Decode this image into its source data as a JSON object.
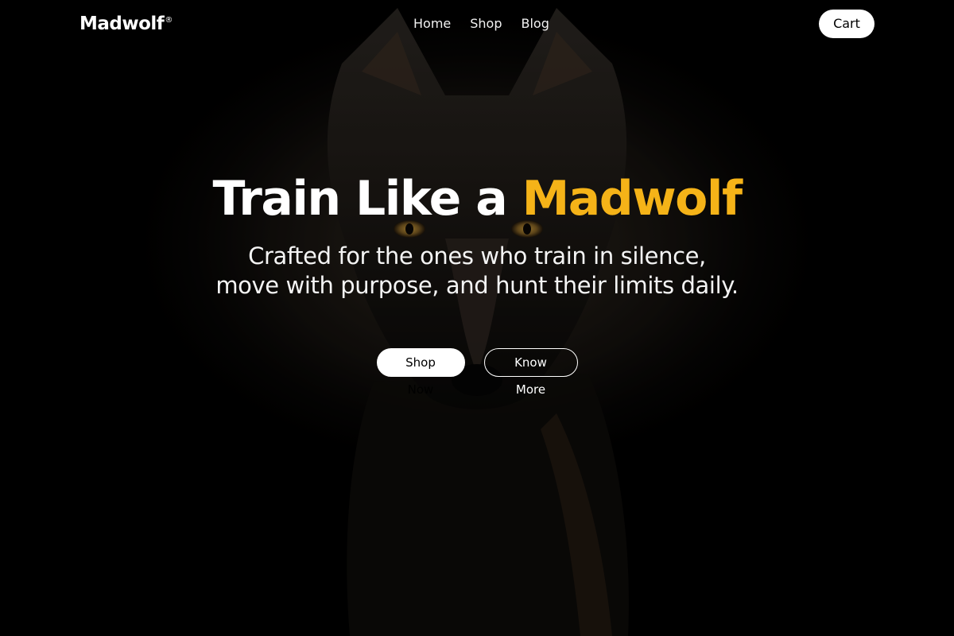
{
  "brand": {
    "name": "Madwolf",
    "mark": "®"
  },
  "nav": {
    "items": [
      {
        "label": "Home"
      },
      {
        "label": "Shop"
      },
      {
        "label": "Blog"
      }
    ]
  },
  "header": {
    "cart_label": "Cart"
  },
  "hero": {
    "title_prefix": "Train Like a ",
    "title_accent": "Madwolf",
    "subtitle_line1": "Crafted for the ones who train in silence,",
    "subtitle_line2": "move with purpose, and hunt their limits daily.",
    "primary_cta": "Shop Now",
    "secondary_cta": "Know More",
    "background_image": "wolf-photo"
  },
  "colors": {
    "background": "#000000",
    "accent": "#f5b318",
    "text": "#ffffff",
    "button_bg": "#ffffff"
  }
}
